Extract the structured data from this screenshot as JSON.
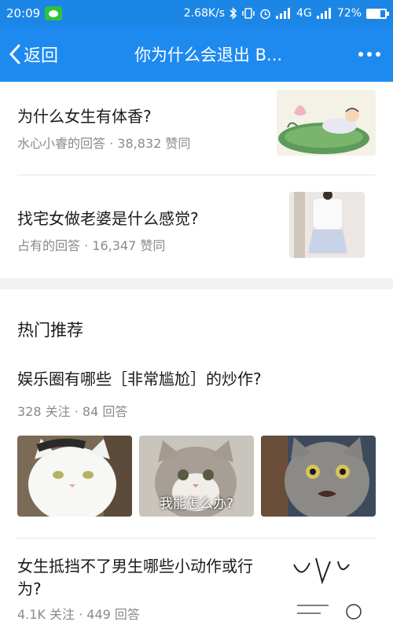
{
  "status": {
    "time": "20:09",
    "network_speed": "2.68K/s",
    "signal_label": "4G",
    "battery": "72%",
    "battery_level": 0.72
  },
  "nav": {
    "back_label": "返回",
    "title": "你为什么会退出 B..."
  },
  "answers": [
    {
      "question": "为什么女生有体香?",
      "meta": "水心小睿的回答 · 38,832 赞同",
      "thumb_icon": "lotus-illustration"
    },
    {
      "question": "找宅女做老婆是什么感觉?",
      "meta": "占有的回答 · 16,347 赞同",
      "thumb_icon": "outfit-photo"
    }
  ],
  "hot": {
    "title": "热门推荐",
    "topics": [
      {
        "title": "娱乐圈有哪些［非常尴尬］的炒作?",
        "meta": "328 关注 · 84 回答"
      },
      {
        "title": "女生抵挡不了男生哪些小动作或行为?",
        "meta": "4.1K 关注 · 449 回答"
      }
    ],
    "cat_caption": "我能怎么办?"
  }
}
